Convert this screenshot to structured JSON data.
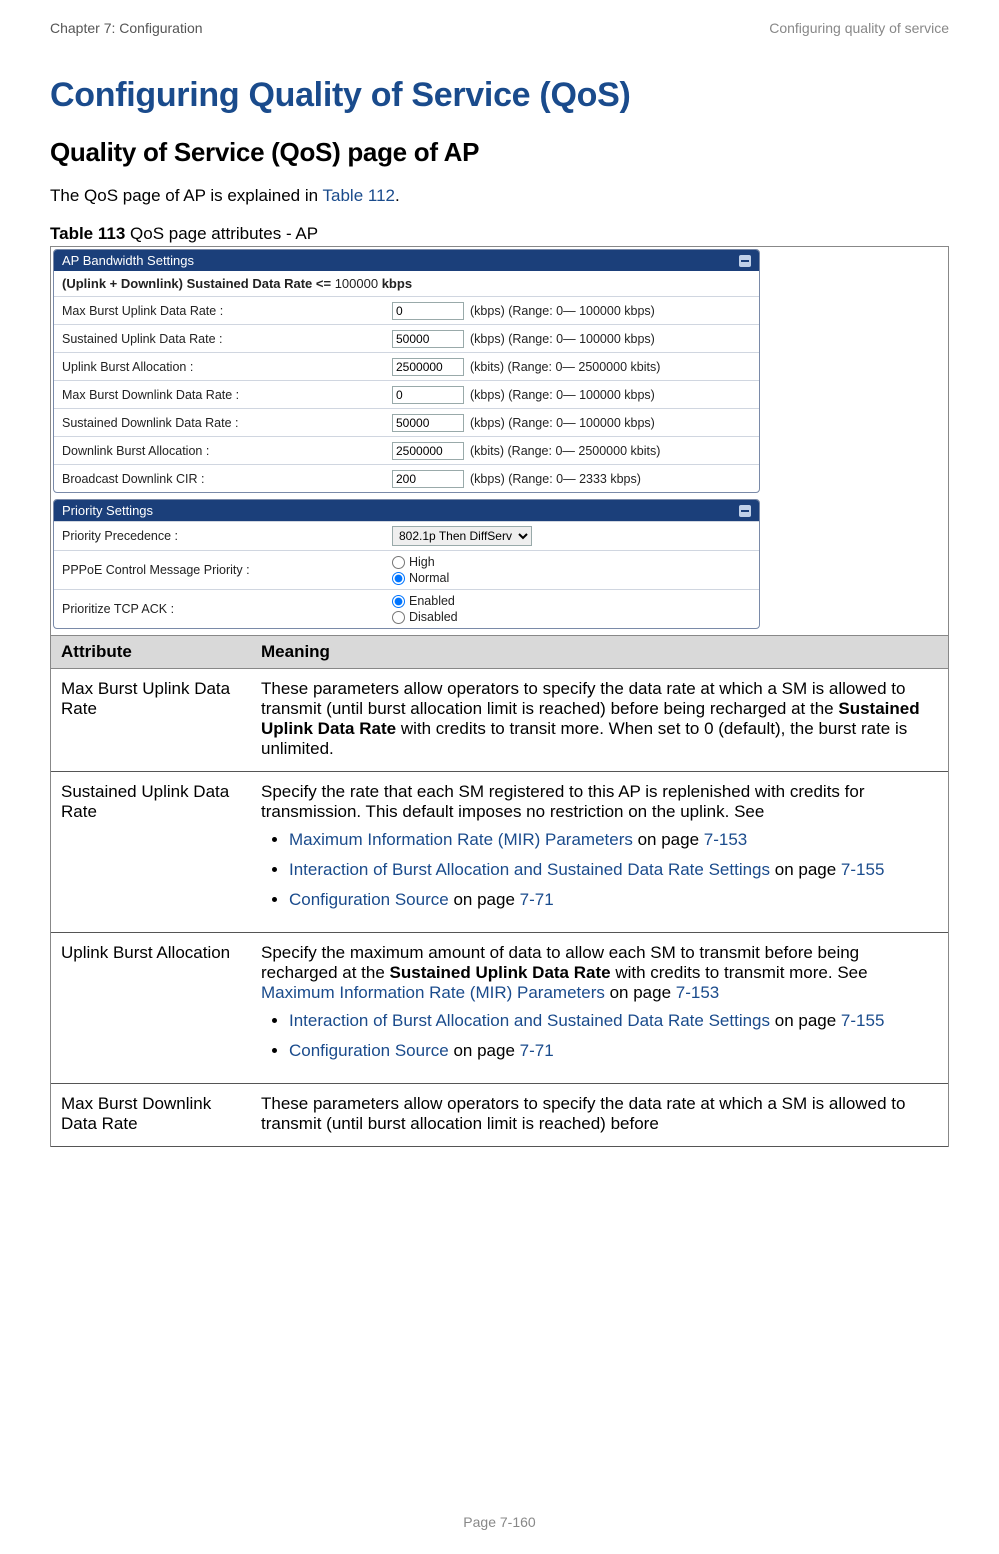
{
  "header": {
    "left": "Chapter 7:  Configuration",
    "right": "Configuring quality of service"
  },
  "h1": "Configuring Quality of Service (QoS)",
  "h2": "Quality of Service (QoS) page of AP",
  "intro": {
    "pre": "The QoS page of AP is explained in ",
    "link": "Table 112",
    "post": "."
  },
  "caption": {
    "bold": "Table 113",
    "rest": " QoS page attributes - AP"
  },
  "panel1": {
    "title": "AP Bandwidth Settings",
    "sub_pre": "(Uplink + Downlink) Sustained Data Rate <= ",
    "sub_val": "100000",
    "sub_unit": " kbps",
    "rows": [
      {
        "label": "Max Burst Uplink Data Rate :",
        "val": "0",
        "suffix": "(kbps) (Range: 0— 100000 kbps)"
      },
      {
        "label": "Sustained Uplink Data Rate :",
        "val": "50000",
        "suffix": "(kbps) (Range: 0— 100000 kbps)"
      },
      {
        "label": "Uplink Burst Allocation :",
        "val": "2500000",
        "suffix": "(kbits) (Range: 0— 2500000 kbits)"
      },
      {
        "label": "Max Burst Downlink Data Rate :",
        "val": "0",
        "suffix": "(kbps) (Range: 0— 100000 kbps)"
      },
      {
        "label": "Sustained Downlink Data Rate :",
        "val": "50000",
        "suffix": "(kbps) (Range: 0— 100000 kbps)"
      },
      {
        "label": "Downlink Burst Allocation :",
        "val": "2500000",
        "suffix": "(kbits) (Range: 0— 2500000 kbits)"
      },
      {
        "label": "Broadcast Downlink CIR :",
        "val": "200",
        "suffix": "(kbps) (Range: 0— 2333 kbps)"
      }
    ]
  },
  "panel2": {
    "title": "Priority Settings",
    "precedence": {
      "label": "Priority Precedence :",
      "selected": "802.1p Then DiffServ"
    },
    "pppoe": {
      "label": "PPPoE Control Message Priority :",
      "opts": [
        "High",
        "Normal"
      ],
      "sel": 1
    },
    "tcpack": {
      "label": "Prioritize TCP ACK :",
      "opts": [
        "Enabled",
        "Disabled"
      ],
      "sel": 0
    }
  },
  "table": {
    "h_attr": "Attribute",
    "h_mean": "Meaning",
    "rows": [
      {
        "attr": "Max Burst Uplink Data Rate",
        "meaning": {
          "pre": "These parameters allow operators to specify the data rate at which a SM is allowed to transmit (until burst allocation limit is reached) before being recharged at the ",
          "bold": "Sustained Uplink Data Rate",
          "post": " with credits to transit more. When set to 0 (default), the burst rate is unlimited."
        }
      },
      {
        "attr": "Sustained Uplink Data Rate",
        "meaning_text": "Specify the rate that each SM registered to this AP is replenished with credits for transmission. This default imposes no restriction on the uplink. See",
        "bullets": [
          {
            "link": "Maximum Information Rate (MIR) Parameters",
            "mid": " on page ",
            "page": "7-153"
          },
          {
            "link": "Interaction of Burst Allocation and Sustained Data Rate Settings",
            "mid": " on page ",
            "page": "7-155"
          },
          {
            "link": "Configuration Source",
            "mid": " on page ",
            "page": "7-71"
          }
        ]
      },
      {
        "attr": "Uplink Burst Allocation",
        "meaning": {
          "pre": "Specify the maximum amount of data to allow each SM to transmit before being recharged at the ",
          "bold": "Sustained Uplink Data Rate",
          "post": " with credits to transmit more. See ",
          "link": "Maximum Information Rate (MIR) Parameters",
          "mid": " on page ",
          "page": "7-153"
        },
        "bullets": [
          {
            "link": "Interaction of Burst Allocation and Sustained Data Rate Settings",
            "mid": " on page ",
            "page": "7-155"
          },
          {
            "link": "Configuration Source",
            "mid": " on page ",
            "page": "7-71"
          }
        ]
      },
      {
        "attr": "Max Burst Downlink Data Rate",
        "meaning_text": "These parameters allow operators to specify the data rate at which a SM is allowed to transmit (until burst allocation limit is reached) before"
      }
    ]
  },
  "footer": "Page 7-160"
}
